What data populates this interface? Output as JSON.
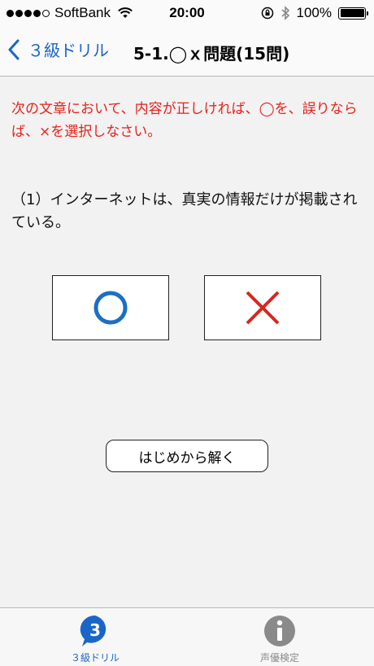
{
  "status_bar": {
    "carrier": "SoftBank",
    "time": "20:00",
    "battery": "100%"
  },
  "nav": {
    "back_label": "３級ドリル",
    "title": "5-1.◯ｘ問題(15問)"
  },
  "content": {
    "instruction": "次の文章において、内容が正しければ、◯を、誤りならば、×を選択しなさい。",
    "question": "（1）インターネットは、真実の情報だけが掲載されている。",
    "restart_label": "はじめから解く"
  },
  "tabs": [
    {
      "label": "３級ドリル",
      "icon": "drill-3-icon",
      "active": true
    },
    {
      "label": "声優検定",
      "icon": "info-icon",
      "active": false
    }
  ],
  "colors": {
    "accent_blue": "#1a66c8",
    "instruction_red": "#e8201a",
    "cross_red": "#d9261c",
    "maru_blue": "#1b6fc2"
  }
}
